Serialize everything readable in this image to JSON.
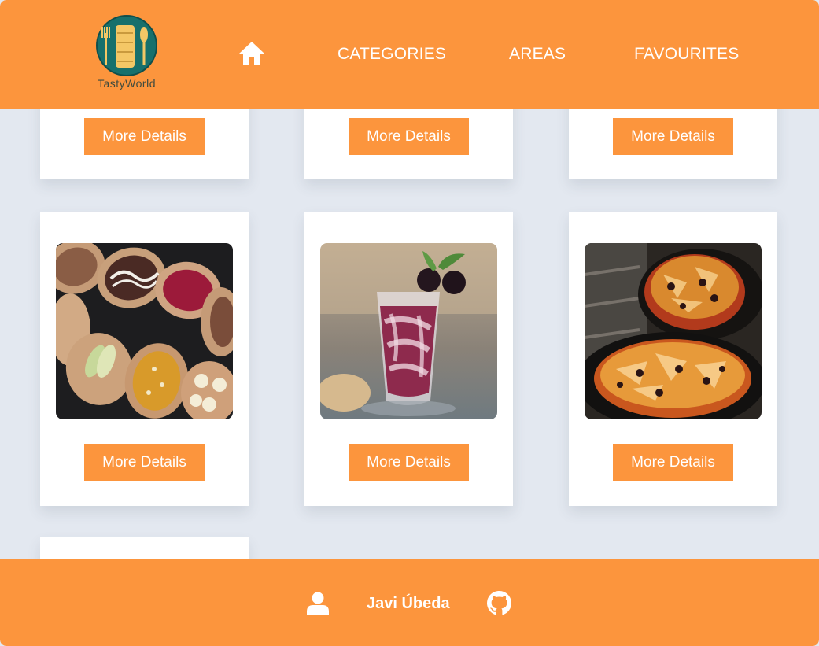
{
  "header": {
    "logo_text": "TastyWorld",
    "nav": {
      "categories": "CATEGORIES",
      "areas": "AREAS",
      "favourites": "FAVOURITES"
    }
  },
  "cards": {
    "button_label": "More Details"
  },
  "footer": {
    "author": "Javi Úbeda"
  },
  "colors": {
    "accent": "#fc953d",
    "background": "#e3e8f0",
    "card": "#ffffff"
  },
  "icons": {
    "home": "home-icon",
    "user": "user-icon",
    "github": "github-icon"
  }
}
